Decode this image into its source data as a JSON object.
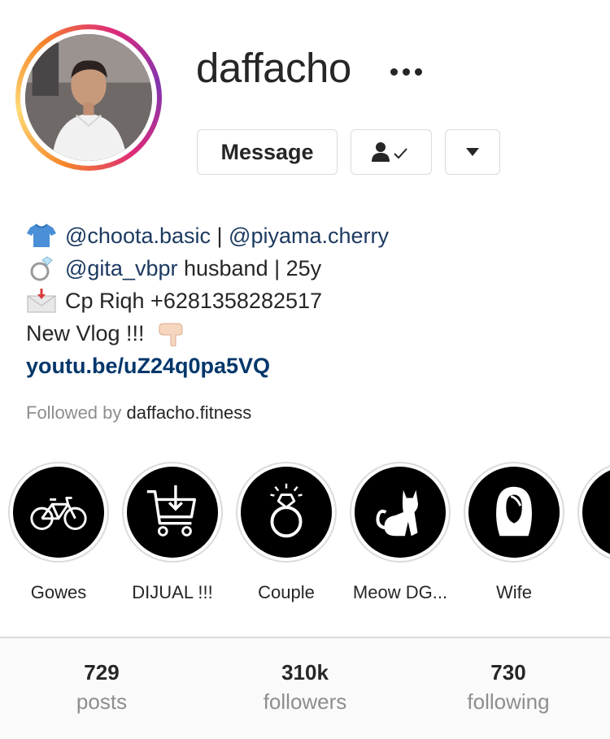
{
  "profile": {
    "username": "daffacho",
    "more_icon": "more-horizontal-icon",
    "avatar_icon": "profile-photo"
  },
  "actions": {
    "message_label": "Message",
    "follow_icon": "person-check-icon",
    "dropdown_icon": "caret-down-icon"
  },
  "bio": {
    "line1": {
      "emoji": "shirt",
      "mention_a": "@choota.basic",
      "sep": " | ",
      "mention_b": "@piyama.cherry"
    },
    "line2": {
      "emoji": "ring",
      "mention": "@gita_vbpr",
      "text": " husband | 25y"
    },
    "line3": {
      "emoji": "envelope-arrow",
      "text": "Cp Riqh +6281358282517"
    },
    "line4": {
      "text": "New Vlog !!!",
      "emoji": "pointing-down"
    },
    "link": "youtu.be/uZ24q0pa5VQ"
  },
  "followed_by": {
    "prefix": "Followed by",
    "name": "daffacho.fitness"
  },
  "highlights": [
    {
      "label": "Gowes",
      "icon": "bicycle-icon"
    },
    {
      "label": "DIJUAL !!!",
      "icon": "shopping-cart-icon"
    },
    {
      "label": "Couple",
      "icon": "diamond-ring-icon"
    },
    {
      "label": "Meow DG...",
      "icon": "cat-icon"
    },
    {
      "label": "Wife",
      "icon": "woman-silhouette-icon"
    }
  ],
  "stats": {
    "posts": {
      "value": "729",
      "label": "posts"
    },
    "followers": {
      "value": "310k",
      "label": "followers"
    },
    "following": {
      "value": "730",
      "label": "following"
    }
  },
  "colors": {
    "text": "#262626",
    "muted": "#8e8e8e",
    "link": "#00376b",
    "border": "#dbdbdb"
  }
}
